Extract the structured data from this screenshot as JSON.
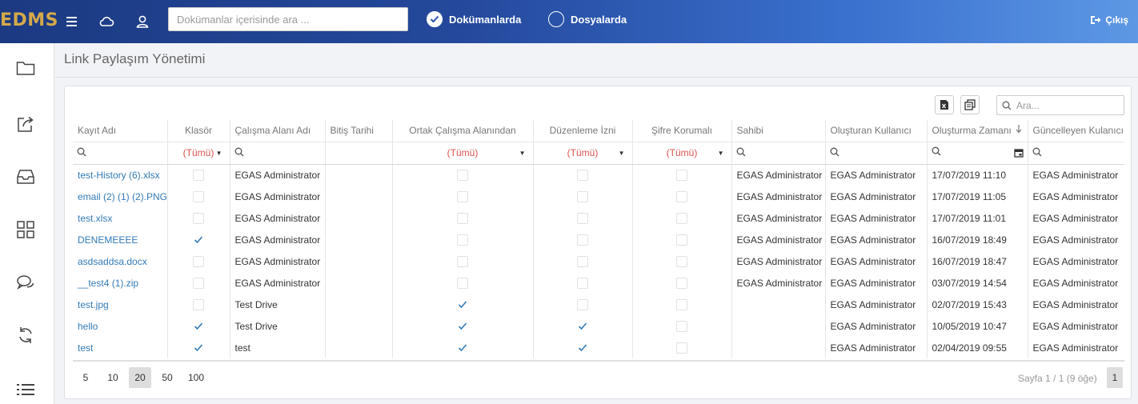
{
  "header": {
    "logo": "EDMS",
    "search_placeholder": "Dokümanlar içerisinde ara ...",
    "scope_docs": "Dokümanlarda",
    "scope_files": "Dosyalarda",
    "logout": "Çıkış"
  },
  "page": {
    "title": "Link Paylaşım Yönetimi"
  },
  "grid": {
    "search_placeholder": "Ara...",
    "columns": [
      "Kayıt Adı",
      "Klasör",
      "Çalışma Alanı Adı",
      "Bitiş Tarihi",
      "Ortak Çalışma Alanından",
      "Düzenleme İzni",
      "Şifre Korumalı",
      "Sahibi",
      "Oluşturan Kullanıcı",
      "Oluşturma Zamanı",
      "Güncelleyen Kulanıcı"
    ],
    "filter_all": "(Tümü)",
    "rows": [
      {
        "name": "test-History (6).xlsx",
        "folder": false,
        "workspace": "EGAS Administrator",
        "end_date": "",
        "shared": false,
        "edit": false,
        "pwd": false,
        "owner": "EGAS Administrator",
        "creator": "EGAS Administrator",
        "created": "17/07/2019 11:10",
        "updater": "EGAS Administrator"
      },
      {
        "name": "email (2) (1) (2).PNG",
        "folder": false,
        "workspace": "EGAS Administrator",
        "end_date": "",
        "shared": false,
        "edit": false,
        "pwd": false,
        "owner": "EGAS Administrator",
        "creator": "EGAS Administrator",
        "created": "17/07/2019 11:05",
        "updater": "EGAS Administrator"
      },
      {
        "name": "test.xlsx",
        "folder": false,
        "workspace": "EGAS Administrator",
        "end_date": "",
        "shared": false,
        "edit": false,
        "pwd": false,
        "owner": "EGAS Administrator",
        "creator": "EGAS Administrator",
        "created": "17/07/2019 11:01",
        "updater": "EGAS Administrator"
      },
      {
        "name": "DENEMEEEE",
        "folder": true,
        "workspace": "EGAS Administrator",
        "end_date": "",
        "shared": false,
        "edit": false,
        "pwd": false,
        "owner": "EGAS Administrator",
        "creator": "EGAS Administrator",
        "created": "16/07/2019 18:49",
        "updater": "EGAS Administrator"
      },
      {
        "name": "asdsaddsa.docx",
        "folder": false,
        "workspace": "EGAS Administrator",
        "end_date": "",
        "shared": false,
        "edit": false,
        "pwd": false,
        "owner": "EGAS Administrator",
        "creator": "EGAS Administrator",
        "created": "16/07/2019 18:47",
        "updater": "EGAS Administrator"
      },
      {
        "name": "__test4 (1).zip",
        "folder": false,
        "workspace": "EGAS Administrator",
        "end_date": "",
        "shared": false,
        "edit": false,
        "pwd": false,
        "owner": "EGAS Administrator",
        "creator": "EGAS Administrator",
        "created": "03/07/2019 14:54",
        "updater": "EGAS Administrator"
      },
      {
        "name": "test.jpg",
        "folder": false,
        "workspace": "Test Drive",
        "end_date": "",
        "shared": true,
        "edit": false,
        "pwd": false,
        "owner": "",
        "creator": "EGAS Administrator",
        "created": "02/07/2019 15:43",
        "updater": "EGAS Administrator"
      },
      {
        "name": "hello",
        "folder": true,
        "workspace": "Test Drive",
        "end_date": "",
        "shared": true,
        "edit": true,
        "pwd": false,
        "owner": "",
        "creator": "EGAS Administrator",
        "created": "10/05/2019 10:47",
        "updater": "EGAS Administrator"
      },
      {
        "name": "test",
        "folder": true,
        "workspace": "test",
        "end_date": "",
        "shared": true,
        "edit": true,
        "pwd": false,
        "owner": "",
        "creator": "EGAS Administrator",
        "created": "02/04/2019 09:55",
        "updater": "EGAS Administrator"
      }
    ],
    "page_sizes": [
      "5",
      "10",
      "20",
      "50",
      "100"
    ],
    "selected_page_size": "20",
    "page_info": "Sayfa 1 / 1 (9 öğe)",
    "current_page": "1"
  },
  "colors": {
    "accent": "#337ab7",
    "filter": "#d9534f",
    "check": "#337ab7"
  }
}
